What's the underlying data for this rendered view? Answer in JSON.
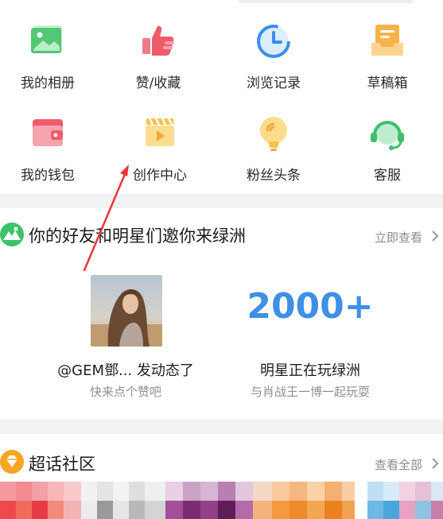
{
  "shortcuts": [
    {
      "label": "我的相册",
      "icon": "photo-album-icon"
    },
    {
      "label": "赞/收藏",
      "icon": "thumbs-up-icon"
    },
    {
      "label": "浏览记录",
      "icon": "history-clock-icon"
    },
    {
      "label": "草稿箱",
      "icon": "drafts-tray-icon"
    },
    {
      "label": "我的钱包",
      "icon": "wallet-icon"
    },
    {
      "label": "创作中心",
      "icon": "creation-clapper-icon"
    },
    {
      "label": "粉丝头条",
      "icon": "fans-headline-bulb-icon"
    },
    {
      "label": "客服",
      "icon": "customer-service-headset-icon"
    }
  ],
  "invite": {
    "title": "你的好友和明星们邀你来绿洲",
    "more": "立即查看",
    "friend_name": "@GEM鄧... 发动态了",
    "friend_sub": "快来点个赞吧",
    "count": "2000+",
    "star_title": "明星正在玩绿洲",
    "star_sub": "与肖战王一博一起玩耍"
  },
  "topic": {
    "title": "超话社区",
    "more": "查看全部"
  },
  "colors": {
    "accent_blue": "#3f8fe6",
    "annotation_red": "#e8373a",
    "oasis_green": "#3cc26b",
    "topic_orange": "#f6a623"
  }
}
